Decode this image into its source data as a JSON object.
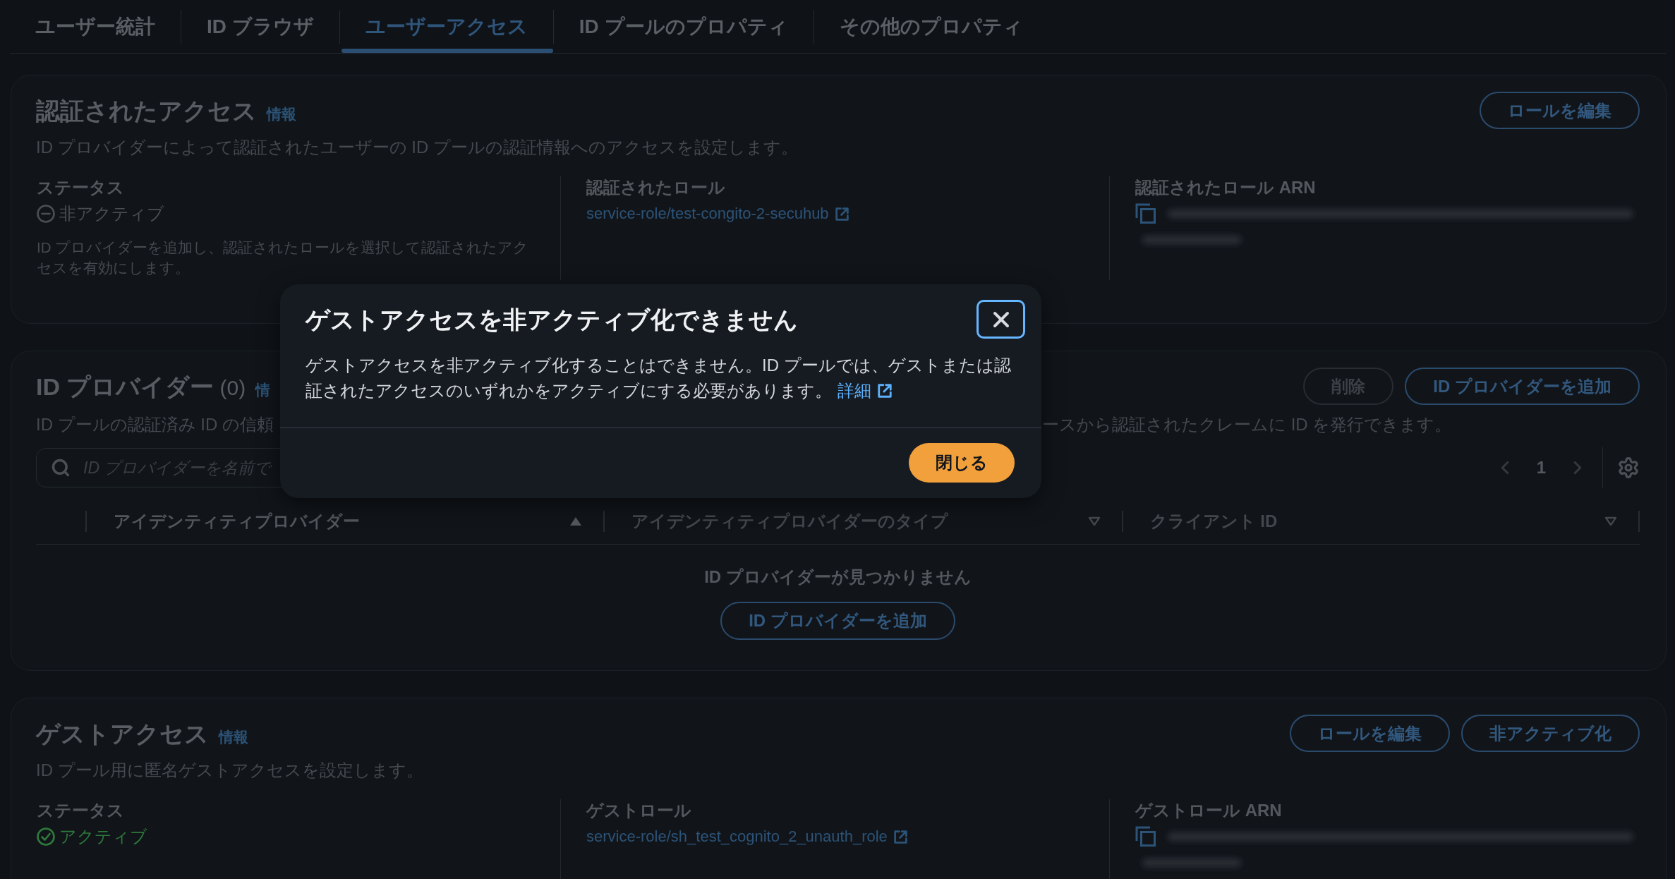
{
  "tabs": [
    {
      "label": "ユーザー統計",
      "selected": false
    },
    {
      "label": "ID ブラウザ",
      "selected": false
    },
    {
      "label": "ユーザーアクセス",
      "selected": true
    },
    {
      "label": "ID プールのプロパティ",
      "selected": false
    },
    {
      "label": "その他のプロパティ",
      "selected": false
    }
  ],
  "authenticated_access": {
    "title": "認証されたアクセス",
    "info_link": "情報",
    "description": "ID プロバイダーによって認証されたユーザーの ID プールの認証情報へのアクセスを設定します。",
    "buttons": [
      "ロールを編集"
    ],
    "fields": [
      {
        "kind": "status",
        "label": "ステータス",
        "active": false,
        "value": "非アクティブ",
        "note": "ID プロバイダーを追加し、認証されたロールを選択して認証されたアクセスを有効にします。"
      },
      {
        "kind": "link",
        "label": "認証されたロール",
        "value": "service-role/test-congito-2-secuhub"
      },
      {
        "kind": "redacted",
        "label": "認証されたロール ARN"
      }
    ]
  },
  "id_providers": {
    "title": "ID プロバイダー",
    "count": "(0)",
    "info_link": "情",
    "description_parts": [
      "ID プールの認証済み ID の信頼",
      "ースから認証されたクレームに ID を発行できます。"
    ],
    "buttons": [
      {
        "label": "削除",
        "disabled": true
      },
      {
        "label": "ID プロバイダーを追加",
        "disabled": false
      }
    ],
    "search": {
      "placeholder": "ID プロバイダーを名前で"
    },
    "pagination": {
      "page": "1"
    },
    "table": {
      "columns": [
        {
          "label": "アイデンティティプロバイダー",
          "sorted": true
        },
        {
          "label": "アイデンティティプロバイダーのタイプ",
          "sorted": false
        },
        {
          "label": "クライアント ID",
          "sorted": false
        }
      ],
      "empty_message": "ID プロバイダーが見つかりません",
      "empty_button": "ID プロバイダーを追加"
    }
  },
  "guest_access": {
    "title": "ゲストアクセス",
    "info_link": "情報",
    "description": "ID プール用に匿名ゲストアクセスを設定します。",
    "buttons": [
      "ロールを編集",
      "非アクティブ化"
    ],
    "fields": [
      {
        "kind": "status",
        "label": "ステータス",
        "active": true,
        "value": "アクティブ"
      },
      {
        "kind": "link",
        "label": "ゲストロール",
        "value": "service-role/sh_test_cognito_2_unauth_role"
      },
      {
        "kind": "redacted",
        "label": "ゲストロール ARN"
      }
    ]
  },
  "dialog": {
    "title": "ゲストアクセスを非アクティブ化できません",
    "body": "ゲストアクセスを非アクティブ化することはできません。ID プールでは、ゲストまたは認証されたアクセスのいずれかをアクティブにする必要があります。",
    "link": "詳細",
    "button": "閉じる"
  }
}
